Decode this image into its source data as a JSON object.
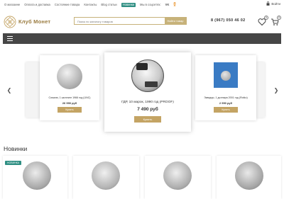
{
  "topbar": {
    "nav": [
      "О магазине",
      "Оплата и доставка",
      "Состояние товара",
      "Контакты",
      "Blog статьи",
      "Новинки",
      "Мы в соцсетях:"
    ],
    "highlight_index": 5,
    "social": [
      "VK",
      "OK"
    ],
    "login_label": "Войти"
  },
  "header": {
    "logo_text": "Клуб Монет",
    "search_placeholder": "Поиск по каталогу товаров",
    "search_button": "Найти товар",
    "phone": "8 (967) 050 46 02",
    "favorites_count": "0",
    "cart_count": "0"
  },
  "carousel": {
    "center": {
      "name": "ГДР, 10 марок, 1990 год (PROOF)",
      "price": "7 490 руб",
      "buy": "Купить"
    },
    "left": {
      "name": "Сомали, 1 шиллинг 1966 год (UNC)",
      "price": "26 990 руб",
      "buy": "Купить"
    },
    "right": {
      "name": "Эквадор, 1 доллара 2001 год (Rotko)",
      "price": "2 990 руб",
      "buy": "Купить"
    }
  },
  "new_section": {
    "title": "Новинки",
    "tag": "НОВИНКА"
  },
  "colors": {
    "accent_gold": "#c4a464",
    "teal": "#2f8f83",
    "menubar": "#464646"
  }
}
